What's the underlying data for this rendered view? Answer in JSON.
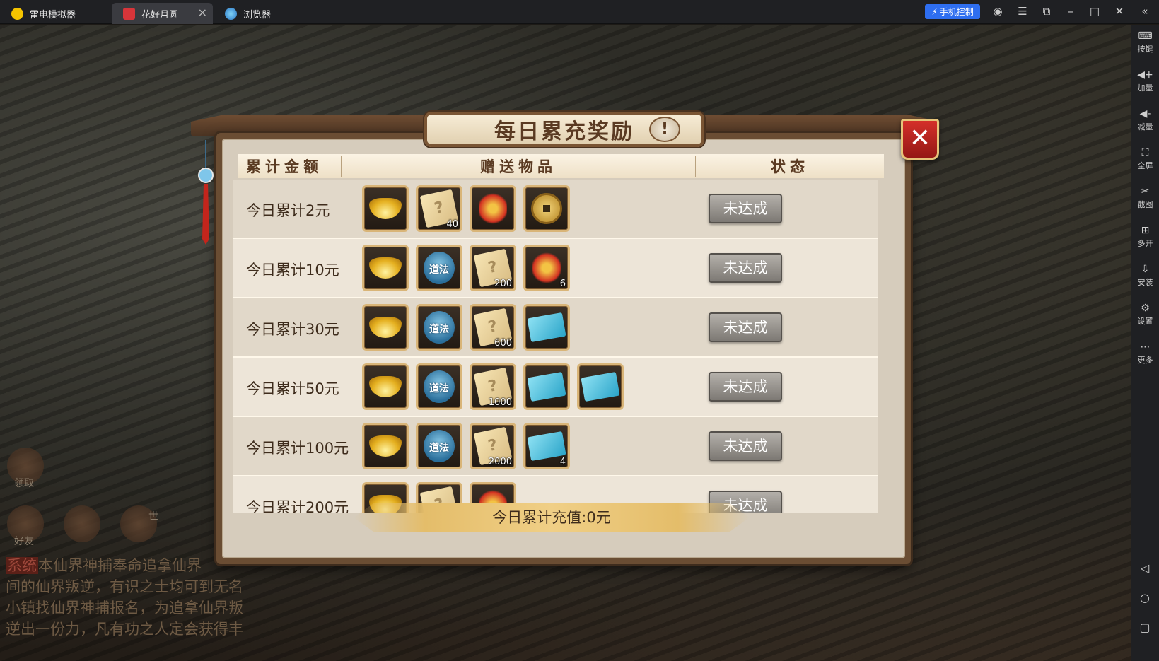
{
  "titlebar": {
    "tabs": [
      {
        "label": "雷电模拟器",
        "icon": "emulator-logo-icon"
      },
      {
        "label": "花好月圆",
        "icon": "game-icon",
        "active": true
      },
      {
        "label": "浏览器",
        "icon": "browser-icon"
      }
    ],
    "phone_control": "手机控制"
  },
  "sidebar": {
    "items": [
      {
        "label": "按键",
        "icon": "keyboard-icon"
      },
      {
        "label": "加量",
        "icon": "volume-up-icon"
      },
      {
        "label": "减量",
        "icon": "volume-down-icon"
      },
      {
        "label": "全屏",
        "icon": "fullscreen-icon"
      },
      {
        "label": "截图",
        "icon": "scissors-icon"
      },
      {
        "label": "多开",
        "icon": "multi-instance-icon"
      },
      {
        "label": "安装",
        "icon": "install-apk-icon"
      },
      {
        "label": "设置",
        "icon": "settings-icon"
      },
      {
        "label": "更多",
        "icon": "more-icon"
      }
    ]
  },
  "hud": {
    "receive": "领取",
    "friends": "好友",
    "world": "世"
  },
  "chat": {
    "tag": "系统",
    "lines": [
      "本仙界神捕奉命追拿仙界",
      "间的仙界叛逆，有识之士均可到无名",
      "小镇找仙界神捕报名，为追拿仙界叛",
      "逆出一份力，凡有功之人定会获得丰"
    ]
  },
  "dialog": {
    "title": "每日累充奖励",
    "info_button": "!",
    "close_button": "✕",
    "columns": [
      "累计金额",
      "赠送物品",
      "状态"
    ],
    "rows": [
      {
        "label": "今日累计2元",
        "status": "未达成",
        "items": [
          {
            "kind": "ingot",
            "name": "gold-ingot-icon"
          },
          {
            "kind": "scroll",
            "name": "mystery-scroll-icon",
            "count": "40"
          },
          {
            "kind": "firework",
            "name": "firecracker-icon"
          },
          {
            "kind": "coin",
            "name": "copper-coin-icon"
          }
        ]
      },
      {
        "label": "今日累计10元",
        "status": "未达成",
        "items": [
          {
            "kind": "ingot",
            "name": "gold-ingot-icon"
          },
          {
            "kind": "gourd",
            "name": "daofa-gourd-icon",
            "text": "道法"
          },
          {
            "kind": "scroll",
            "name": "mystery-scroll-icon",
            "count": "200"
          },
          {
            "kind": "firework",
            "name": "firecracker-icon",
            "count": "6"
          }
        ]
      },
      {
        "label": "今日累计30元",
        "status": "未达成",
        "items": [
          {
            "kind": "ingot",
            "name": "gold-ingot-icon"
          },
          {
            "kind": "gourd",
            "name": "daofa-gourd-icon",
            "text": "道法"
          },
          {
            "kind": "scroll",
            "name": "mystery-scroll-icon",
            "count": "600"
          },
          {
            "kind": "gift",
            "name": "blue-gift-icon"
          }
        ]
      },
      {
        "label": "今日累计50元",
        "status": "未达成",
        "items": [
          {
            "kind": "ingot",
            "name": "gold-ingot-icon"
          },
          {
            "kind": "gourd",
            "name": "daofa-gourd-icon",
            "text": "道法"
          },
          {
            "kind": "scroll",
            "name": "mystery-scroll-icon",
            "count": "1000"
          },
          {
            "kind": "gift",
            "name": "blue-gift-icon"
          },
          {
            "kind": "gift",
            "name": "blue-gift-icon"
          }
        ]
      },
      {
        "label": "今日累计100元",
        "status": "未达成",
        "items": [
          {
            "kind": "ingot",
            "name": "gold-ingot-icon"
          },
          {
            "kind": "gourd",
            "name": "daofa-gourd-icon",
            "text": "道法"
          },
          {
            "kind": "scroll",
            "name": "mystery-scroll-icon",
            "count": "2000"
          },
          {
            "kind": "gift",
            "name": "blue-gift-icon",
            "count": "4"
          }
        ]
      },
      {
        "label": "今日累计200元",
        "status": "未达成",
        "items": [
          {
            "kind": "ingot",
            "name": "gold-ingot-icon"
          },
          {
            "kind": "scroll",
            "name": "mystery-scroll-icon"
          },
          {
            "kind": "firework",
            "name": "necklace-icon"
          }
        ]
      }
    ],
    "footer": "今日累计充值:0元"
  }
}
